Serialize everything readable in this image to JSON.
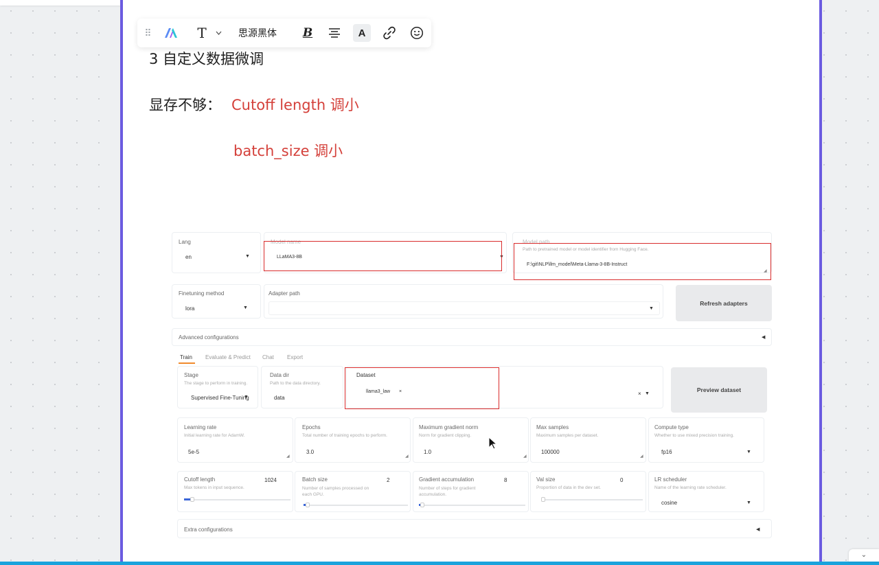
{
  "toolbar": {
    "drag_handle": "⠿",
    "t_label": "T",
    "font_name": "思源黑体",
    "bold_label": "B",
    "color_label": "A"
  },
  "doc": {
    "heading": "3 自定义数据微调",
    "mem_label": "显存不够：",
    "mem_tip1": "Cutoff length 调小",
    "mem_tip2": "batch_size 调小",
    "highlight_color": "#d4403a",
    "accent_border": "#6b5be0"
  },
  "shot": {
    "lang": {
      "label": "Lang",
      "value": "en"
    },
    "model_name": {
      "label": "Model name",
      "value": "LLaMA3-8B"
    },
    "model_path": {
      "label": "Model path",
      "hint": "Path to pretrained model or model identifier from Hugging Face.",
      "value": "F:\\git\\NLP\\llm_model\\Meta-Llama-3-8B-Instruct"
    },
    "finetuning": {
      "label": "Finetuning method",
      "value": "lora"
    },
    "adapter": {
      "label": "Adapter path",
      "value": ""
    },
    "refresh_button": "Refresh adapters",
    "advanced": "Advanced configurations",
    "tabs": [
      "Train",
      "Evaluate & Predict",
      "Chat",
      "Export"
    ],
    "stage": {
      "label": "Stage",
      "hint": "The stage to perform in training.",
      "value": "Supervised Fine-Tuning"
    },
    "data_dir": {
      "label": "Data dir",
      "hint": "Path to the data directory.",
      "value": "data"
    },
    "dataset": {
      "label": "Dataset",
      "value": "llama3_law",
      "clear": "×"
    },
    "preview_button": "Preview dataset",
    "learning_rate": {
      "label": "Learning rate",
      "hint": "Initial learning rate for AdamW.",
      "value": "5e-5"
    },
    "epochs": {
      "label": "Epochs",
      "hint": "Total number of training epochs to perform.",
      "value": "3.0"
    },
    "max_grad_norm": {
      "label": "Maximum gradient norm",
      "hint": "Norm for gradient clipping.",
      "value": "1.0"
    },
    "max_samples": {
      "label": "Max samples",
      "hint": "Maximum samples per dataset.",
      "value": "100000"
    },
    "compute_type": {
      "label": "Compute type",
      "hint": "Whether to use mixed precision training.",
      "value": "fp16"
    },
    "cutoff": {
      "label": "Cutoff length",
      "hint": "Max tokens in input sequence.",
      "value": "1024",
      "fraction": 0.06
    },
    "batch_size": {
      "label": "Batch size",
      "hint": "Number of samples processed on each GPU.",
      "value": "2",
      "fraction": 0.02
    },
    "grad_accum": {
      "label": "Gradient accumulation",
      "hint": "Number of steps for gradient accumulation.",
      "value": "8",
      "fraction": 0.01
    },
    "val_size": {
      "label": "Val size",
      "hint": "Proportion of data in the dev set.",
      "value": "0",
      "fraction": 0
    },
    "lr_scheduler": {
      "label": "LR scheduler",
      "hint": "Name of the learning rate scheduler.",
      "value": "cosine"
    },
    "extra": "Extra configurations"
  },
  "corner": {
    "label": "⌄"
  }
}
